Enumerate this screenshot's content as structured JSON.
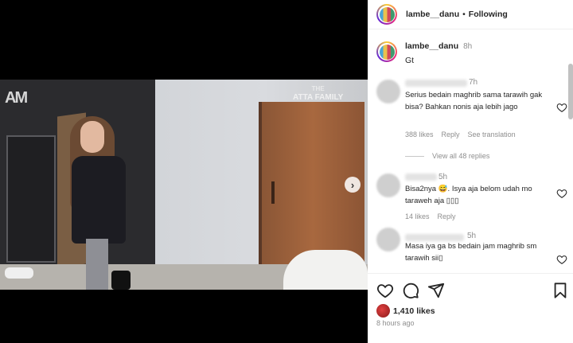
{
  "video": {
    "watermark_logo": "AM",
    "watermark_title_small": "THE",
    "watermark_title": "ATTA FAMILY"
  },
  "header": {
    "username": "lambe__danu",
    "separator": "•",
    "follow_status": "Following"
  },
  "caption": {
    "username": "lambe__danu",
    "time": "8h",
    "text": "Gt"
  },
  "comments": [
    {
      "time": "7h",
      "text": "Serius bedain maghrib sama tarawih gak bisa? Bahkan nonis aja lebih jago",
      "likes": "388 likes",
      "reply": "Reply",
      "translate": "See translation",
      "view_replies": "View all 48 replies"
    },
    {
      "time": "5h",
      "text": "Bisa2nya 😅. Isya aja belom udah mo taraweh aja ▯▯▯",
      "likes": "14 likes",
      "reply": "Reply"
    },
    {
      "time": "5h",
      "text": "Masa iya ga bs bedain jam maghrib sm tarawih sii▯"
    }
  ],
  "footer": {
    "likes": "1,410 likes",
    "ago": "8 hours ago"
  },
  "icons": {
    "next": "chevron-right-icon",
    "like": "heart-icon",
    "comment": "comment-icon",
    "share": "share-icon",
    "save": "bookmark-icon"
  }
}
